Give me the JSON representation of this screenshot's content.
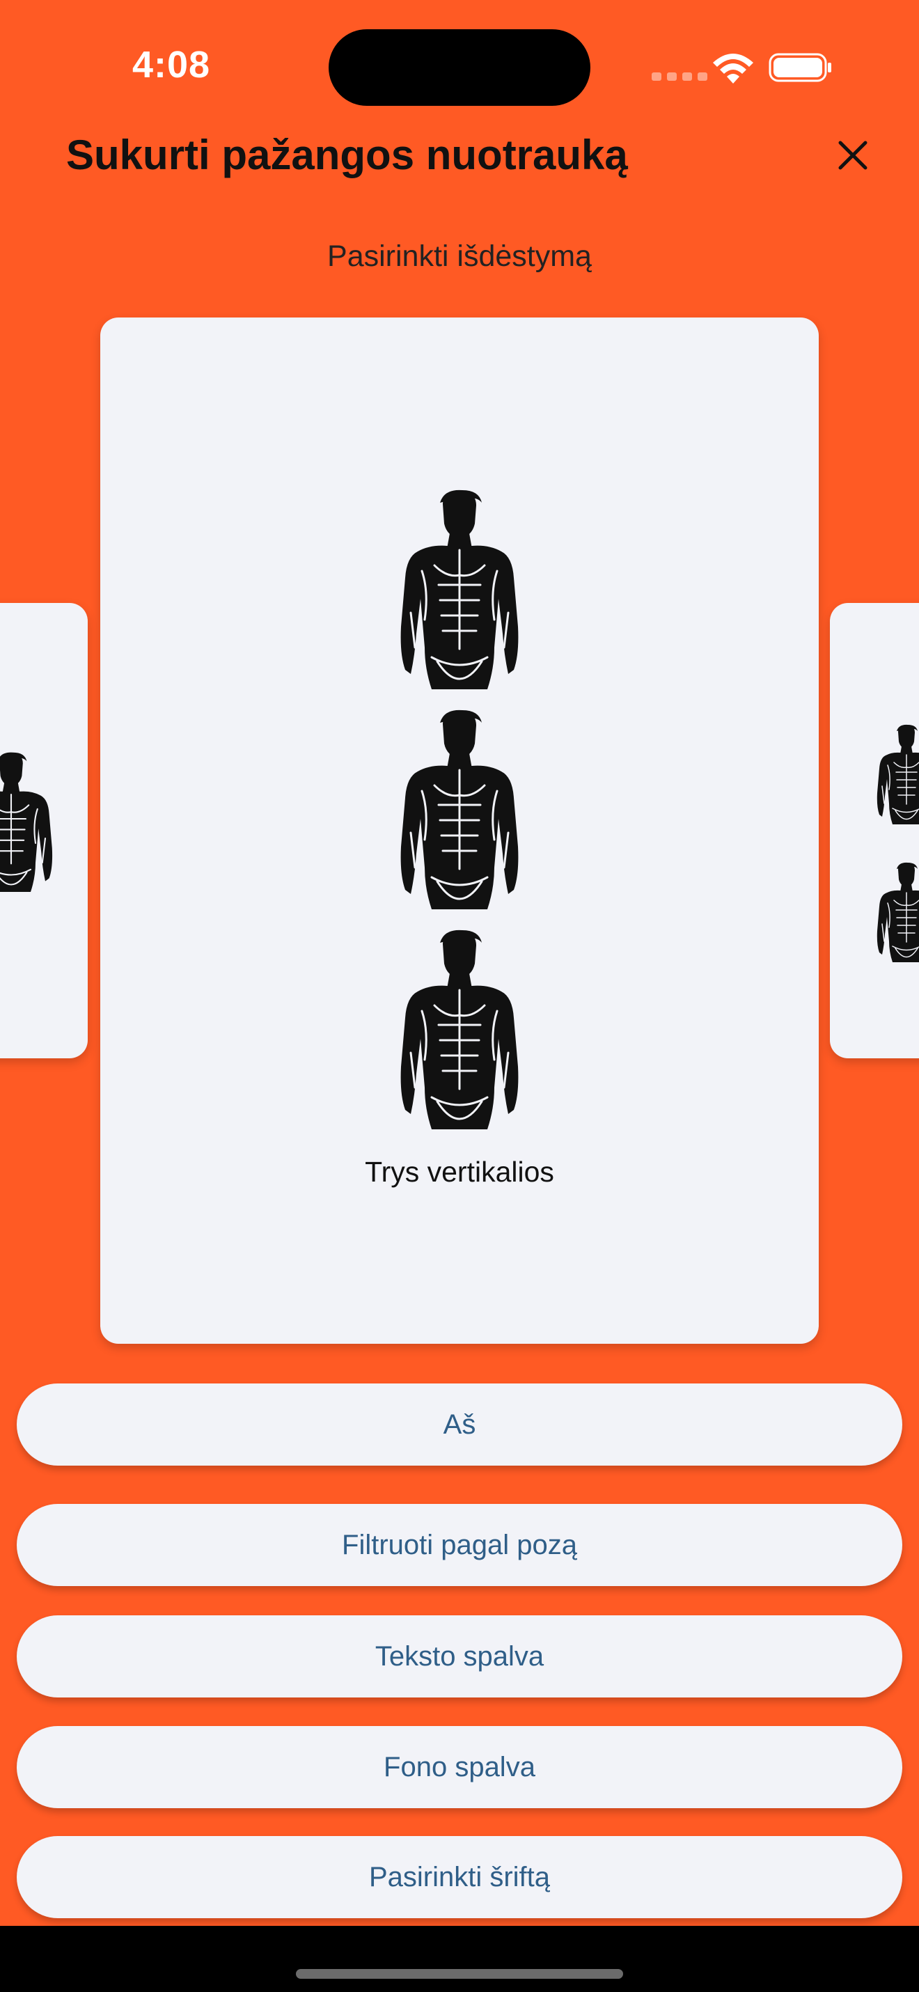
{
  "status_bar": {
    "time": "4:08"
  },
  "header": {
    "title": "Sukurti pažangos nuotrauką",
    "close_icon": "close-icon"
  },
  "layout_picker": {
    "label": "Pasirinkti išdėstymą",
    "selected_layout": "Trys vertikalios",
    "icon": "body-silhouette-icon"
  },
  "options": [
    {
      "label": "Aš"
    },
    {
      "label": "Filtruoti pagal pozą"
    },
    {
      "label": "Teksto spalva"
    },
    {
      "label": "Fono spalva"
    },
    {
      "label": "Pasirinkti šriftą"
    }
  ],
  "colors": {
    "background": "#FF5A24",
    "card": "#F2F3F8",
    "button_text": "#2F5E88"
  }
}
